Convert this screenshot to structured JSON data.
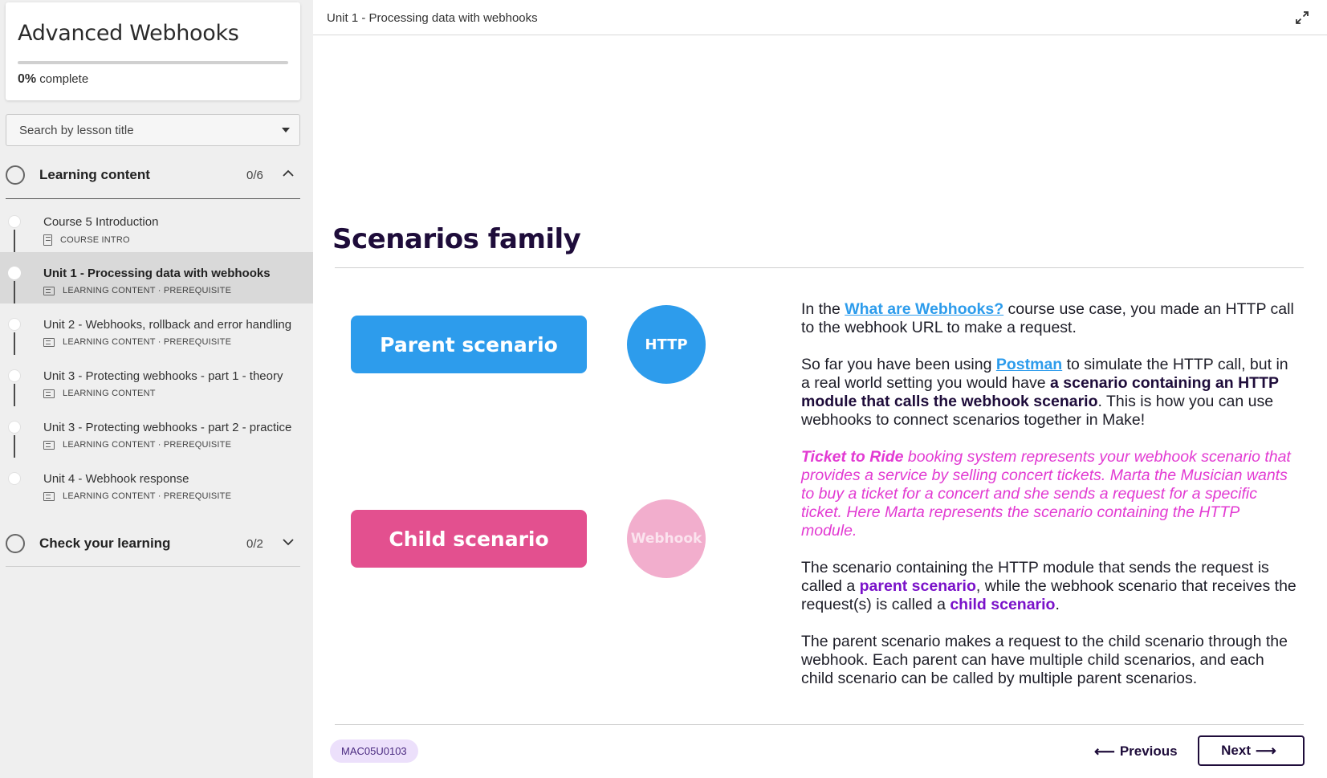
{
  "sidebar": {
    "course_title": "Advanced Webhooks",
    "progress_percent": "0%",
    "progress_label": "complete",
    "progress_fraction": 0,
    "search_placeholder": "Search by lesson title",
    "sections": [
      {
        "label": "Learning content",
        "count": "0/6",
        "expanded": true
      },
      {
        "label": "Check your learning",
        "count": "0/2",
        "expanded": false
      }
    ],
    "lessons": [
      {
        "title": "Course 5 Introduction",
        "meta": "COURSE INTRO",
        "icon": "document-icon",
        "active": false
      },
      {
        "title": "Unit 1 - Processing data with webhooks",
        "meta": "LEARNING CONTENT · PREREQUISITE",
        "icon": "slides-icon",
        "active": true
      },
      {
        "title": "Unit 2 - Webhooks, rollback and error handling",
        "meta": "LEARNING CONTENT · PREREQUISITE",
        "icon": "slides-icon",
        "active": false
      },
      {
        "title": "Unit 3 - Protecting webhooks - part 1 - theory",
        "meta": "LEARNING CONTENT",
        "icon": "slides-icon",
        "active": false
      },
      {
        "title": "Unit 3 - Protecting webhooks - part 2 - practice",
        "meta": "LEARNING CONTENT · PREREQUISITE",
        "icon": "slides-icon",
        "active": false
      },
      {
        "title": "Unit 4 - Webhook response",
        "meta": "LEARNING CONTENT · PREREQUISITE",
        "icon": "slides-icon",
        "active": false
      }
    ]
  },
  "header": {
    "breadcrumb": "Unit 1 - Processing data with webhooks",
    "expand_icon": "expand-icon"
  },
  "slide": {
    "title": "Scenarios family",
    "parent_label": "Parent scenario",
    "child_label": "Child scenario",
    "http_label": "HTTP",
    "webhook_label": "Webhook",
    "p1_pre": "In the ",
    "p1_link": "What are Webhooks?",
    "p1_post": " course use case, you made an HTTP call to the webhook URL to make a request.",
    "p2_pre": "So far you have been using ",
    "p2_link": "Postman",
    "p2_mid": " to simulate the HTTP call, but in a real world setting you would have ",
    "p2_bold": "a scenario containing an HTTP module that calls the webhook scenario",
    "p2_post": ". This is how you can use webhooks to connect scenarios together in Make!",
    "p3_bold": "Ticket to Ride",
    "p3_rest": " booking system represents your webhook scenario that provides a service by selling concert tickets. Marta the Musician wants to buy a ticket for a concert and she sends a request for a specific ticket. Here Marta represents the scenario containing the HTTP module.",
    "p4_pre": "The scenario containing the HTTP module that sends the request is called a ",
    "p4_parent": "parent scenario",
    "p4_mid": ", while the webhook scenario that receives the request(s) is called a ",
    "p4_child": "child scenario",
    "p4_post": ".",
    "p5": "The parent scenario makes a request to the child scenario through the webhook. Each parent can have multiple child scenarios, and each child scenario can be called by multiple parent scenarios."
  },
  "footer": {
    "code": "MAC05U0103",
    "previous_label": "Previous",
    "next_label": "Next"
  },
  "colors": {
    "parent_blue": "#2d9cec",
    "child_pink": "#e3508f",
    "webhook_light_pink": "#f2aecd",
    "story_magenta": "#e23ad2",
    "term_violet": "#7a12c9",
    "heading_navy": "#1e0c3a"
  }
}
